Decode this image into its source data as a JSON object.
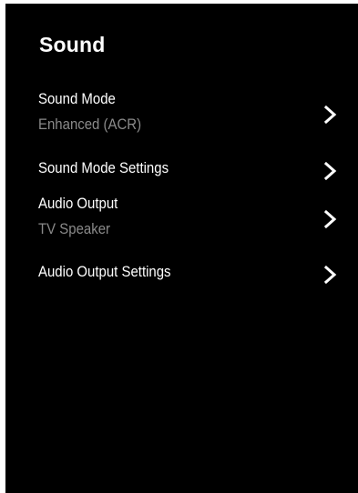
{
  "page": {
    "title": "Sound"
  },
  "colors": {
    "background": "#000000",
    "text": "#ffffff",
    "subtext": "#8a8a8a"
  },
  "menu": {
    "items": [
      {
        "label": "Sound Mode",
        "sublabel": "Enhanced (ACR)",
        "icon": "chevron-right-icon"
      },
      {
        "label": "Sound Mode Settings",
        "icon": "chevron-right-icon"
      },
      {
        "label": "Audio Output",
        "sublabel": "TV Speaker",
        "icon": "chevron-right-icon"
      },
      {
        "label": "Audio Output Settings",
        "icon": "chevron-right-icon"
      }
    ]
  }
}
